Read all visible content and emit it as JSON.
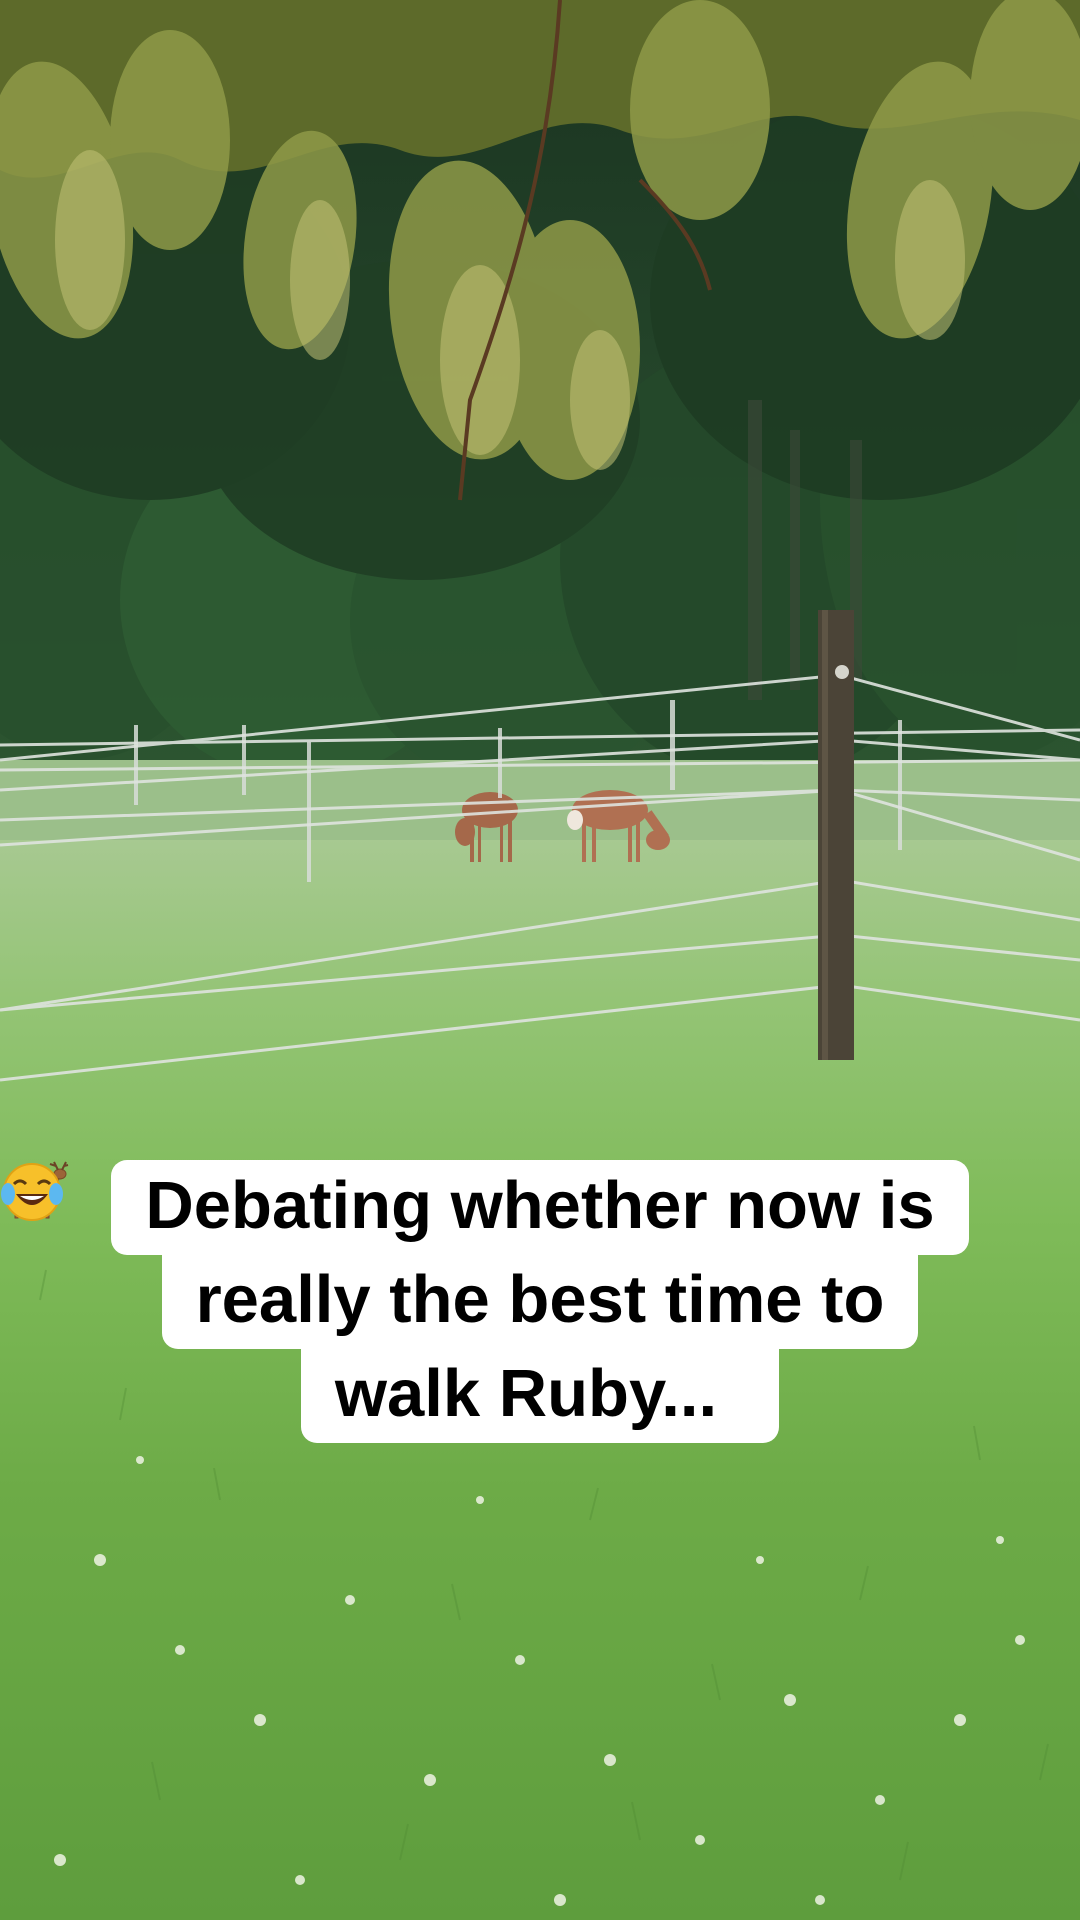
{
  "image": {
    "description_kind": "photo",
    "caption": {
      "line1": "Debating whether now is",
      "line2": "really the best time to",
      "line3_text": "walk Ruby...",
      "emoji_1": "deer-emoji",
      "emoji_2": "tears-of-joy-emoji"
    },
    "colors": {
      "caption_bg": "#ffffff",
      "caption_text": "#000000",
      "forest_dark": "#1f3b22",
      "forest_mid": "#2f5a33",
      "grass_far": "#8fc07a",
      "grass_near": "#6fae4c",
      "deer": "#a0684a",
      "post": "#4a4235",
      "wire": "#d8ddd8"
    }
  }
}
